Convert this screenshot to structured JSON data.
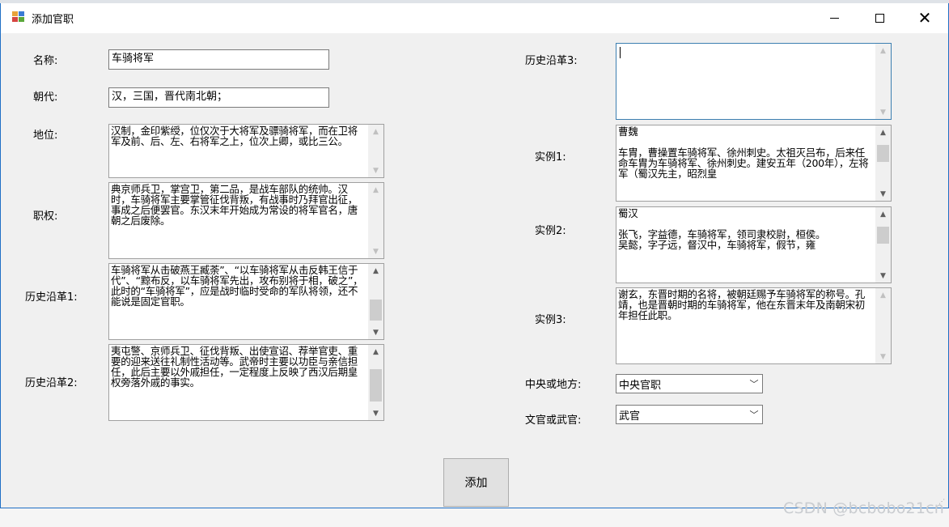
{
  "window": {
    "title": "添加官职",
    "minimize_label": "─",
    "close_label": "✕"
  },
  "form": {
    "name": {
      "label": "名称:",
      "value": "车骑将军"
    },
    "dynasty": {
      "label": "朝代:",
      "value": "汉，三国，晋代南北朝；"
    },
    "status": {
      "label": "地位:",
      "value": "汉制，金印紫绶，位仅次于大将军及骠骑将军，而在卫将军及前、后、左、右将军之上，位次上卿，或比三公。"
    },
    "duties": {
      "label": "职权:",
      "value": "典京师兵卫，掌宫卫，第二品，是战车部队的统帅。汉时，车骑将军主要掌管征伐背叛，有战事时乃拜官出征，事成之后便罢官。东汉末年开始成为常设的将军官名，唐朝之后废除。"
    },
    "history1": {
      "label": "历史沿革1:",
      "value": "车骑将军从击破燕王臧荼”、“以车骑将军从击反韩王信于代”、“黥布反，以车骑将军先出，攻布别将于相，破之”，此时的“车骑将军”，应是战时临时受命的军队将领，还不能说是固定官职。"
    },
    "history2": {
      "label": "历史沿革2:",
      "value": "夷屯警、京师兵卫、征伐背叛、出使宣诏、荐举官吏、重要的迎来送往礼制性活动等。武帝时主要以功臣与亲信担任，此后主要以外戚担任，一定程度上反映了西汉后期皇权旁落外戚的事实。"
    },
    "history3": {
      "label": "历史沿革3:",
      "value": ""
    },
    "example1": {
      "label": "实例1:",
      "value": "曹魏\n\n车胄，曹操置车骑将军、徐州刺史。太祖灭吕布，后来任命车胄为车骑将军、徐州刺史。建安五年（200年），左将军（蜀汉先主，昭烈皇"
    },
    "example2": {
      "label": "实例2:",
      "value": "蜀汉\n\n张飞，字益德，车骑将军，领司隶校尉，桓侯。\n吴懿，字子远，督汉中，车骑将军，假节，雍"
    },
    "example3": {
      "label": "实例3:",
      "value": "谢玄，东晋时期的名将，被朝廷赐予车骑将军的称号。孔靖，也是晋朝时期的车骑将军，他在东晋末年及南朝宋初年担任此职。"
    },
    "central_local": {
      "label": "中央或地方:",
      "selected": "中央官职"
    },
    "civil_military": {
      "label": "文官或武官:",
      "selected": "武官"
    },
    "submit_label": "添加"
  },
  "icons": {
    "scroll_up": "▲",
    "scroll_down": "▼",
    "dropdown": "﹀",
    "resize_grip": "⋰"
  },
  "watermark": "CSDN @bcbobo21cn"
}
